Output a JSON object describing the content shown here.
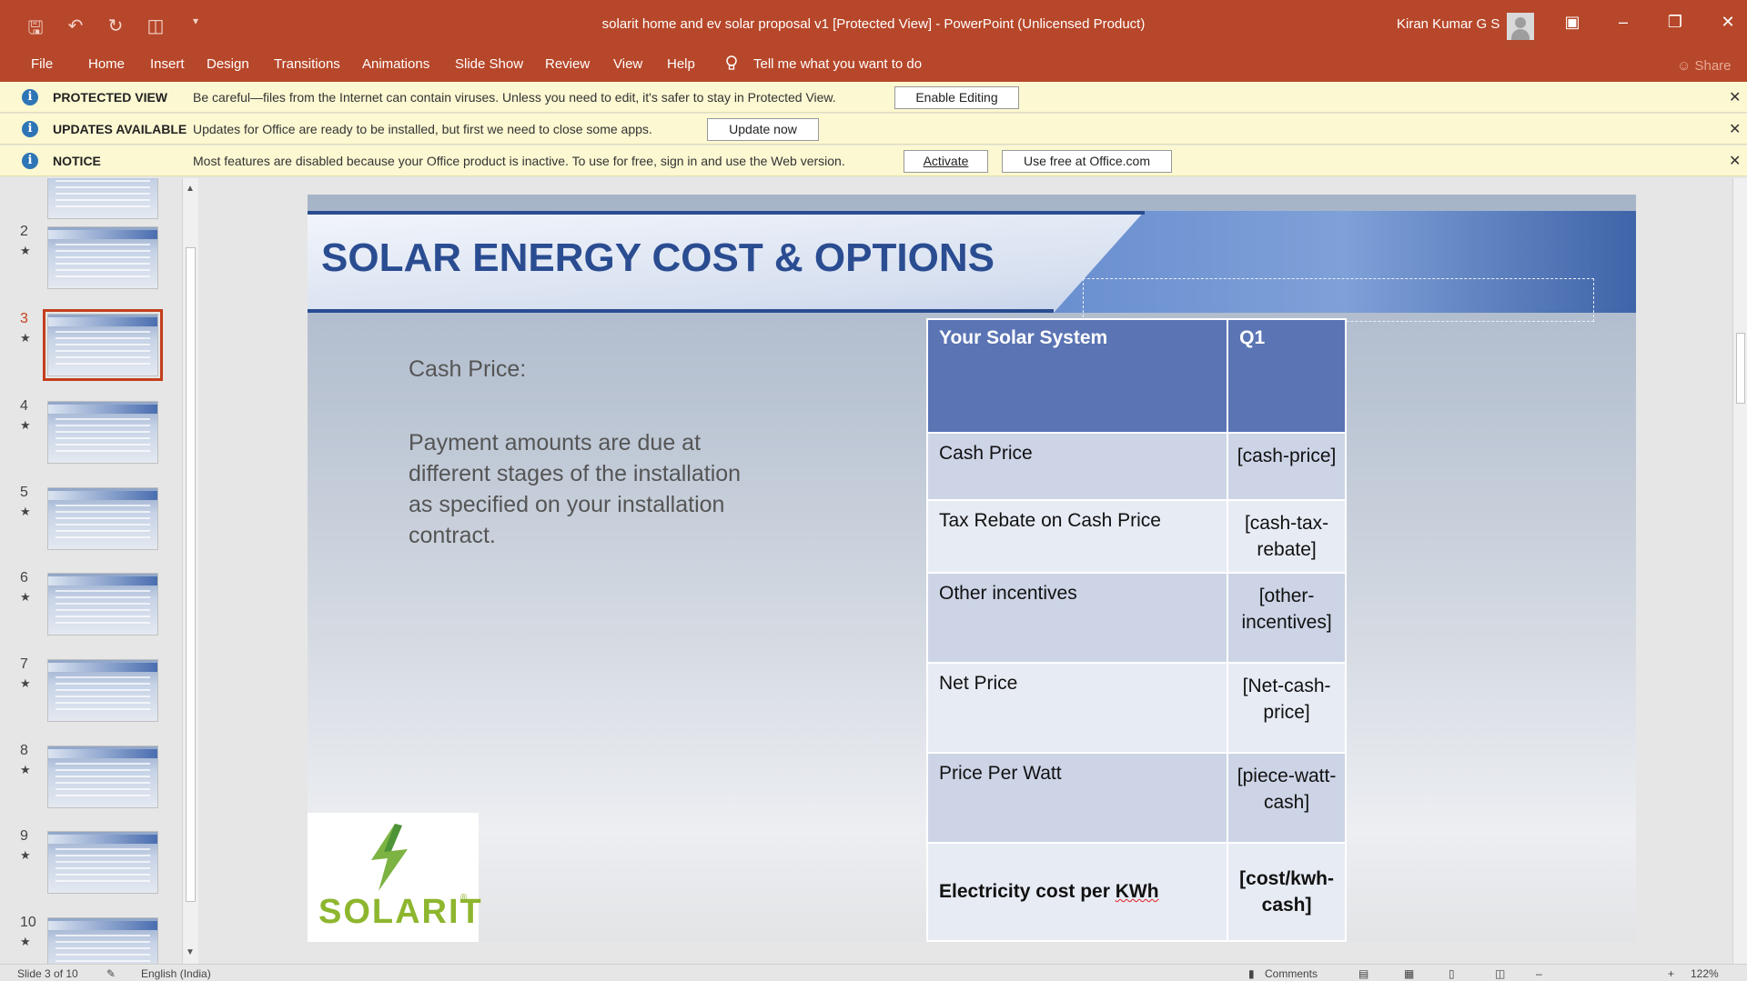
{
  "window": {
    "title": "solarit home and ev solar proposal v1 [Protected View]  -  PowerPoint (Unlicensed Product)",
    "user": "Kiran Kumar G S",
    "accent_color": "#b7472a"
  },
  "ribbon": {
    "tabs": [
      "File",
      "Home",
      "Insert",
      "Design",
      "Transitions",
      "Animations",
      "Slide Show",
      "Review",
      "View",
      "Help"
    ],
    "tell_me": "Tell me what you want to do",
    "share": "Share"
  },
  "message_bars": [
    {
      "label": "PROTECTED VIEW",
      "text": "Be careful—files from the Internet can contain viruses. Unless you need to edit, it's safer to stay in Protected View.",
      "buttons": [
        "Enable Editing"
      ]
    },
    {
      "label": "UPDATES AVAILABLE",
      "text": "Updates for Office are ready to be installed, but first we need to close some apps.",
      "buttons": [
        "Update now"
      ]
    },
    {
      "label": "NOTICE",
      "text": "Most features are disabled because your Office product is inactive. To use for free, sign in and use the Web version.",
      "buttons": [
        "Activate",
        "Use free at Office.com"
      ]
    }
  ],
  "thumbnails": {
    "numbers": [
      "2",
      "3",
      "4",
      "5",
      "6",
      "7",
      "8",
      "9",
      "10"
    ],
    "selected": "3"
  },
  "slide": {
    "title": "SOLAR  ENERGY COST & OPTIONS",
    "cash_label": "Cash Price:",
    "payment_text": "Payment amounts are due at different stages of the installation as specified on your installation contract.",
    "table": {
      "headers": [
        "Your Solar System",
        "Q1"
      ],
      "rows": [
        {
          "label": "Cash Price",
          "value": "[cash-price]"
        },
        {
          "label": "Tax Rebate on Cash Price",
          "value": "[cash-tax-rebate]"
        },
        {
          "label": "Other incentives",
          "value": "[other-incentives]"
        },
        {
          "label": "Net Price",
          "value": "[Net-cash-price]"
        },
        {
          "label": "Price Per Watt",
          "value": "[piece-watt-cash]"
        },
        {
          "label": "Electricity cost per KWh",
          "value": "[cost/kwh-cash]"
        }
      ]
    },
    "logo_text": "SOLARIT",
    "logo_mark": "®"
  },
  "status": {
    "slide_count": "Slide 3 of 10",
    "language": "English (India)",
    "comments": "Comments",
    "zoom": "122%"
  }
}
